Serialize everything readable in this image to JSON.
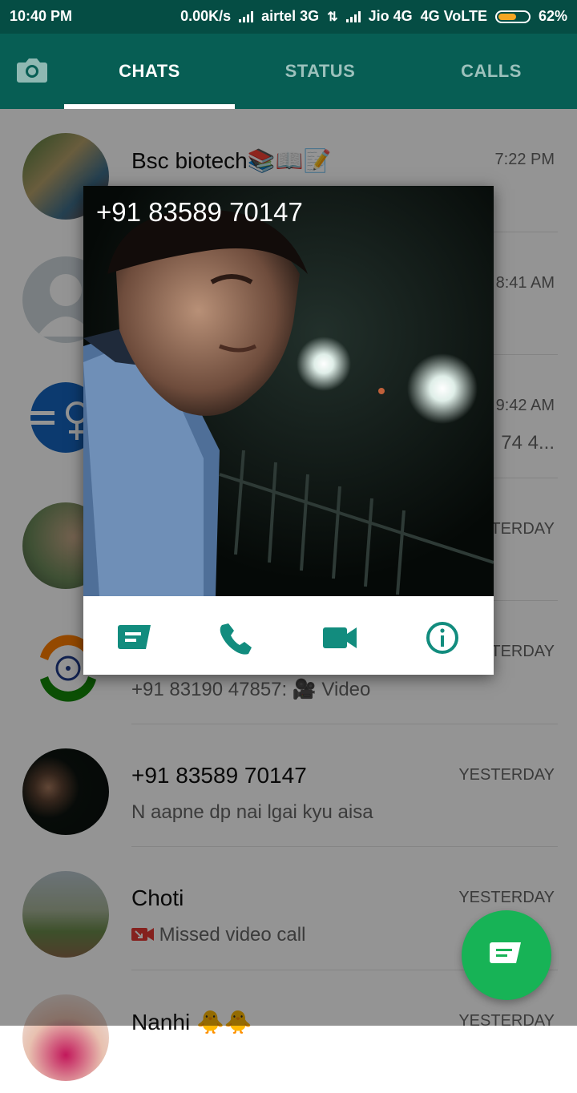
{
  "status_bar": {
    "time": "10:40 PM",
    "speed": "0.00K/s",
    "carrier1": "airtel 3G",
    "carrier2": "Jio 4G",
    "network_type": "4G VoLTE",
    "battery_percent": "62%",
    "battery_level": 0.62
  },
  "tabs": {
    "chats": "CHATS",
    "status": "STATUS",
    "calls": "CALLS"
  },
  "chats": [
    {
      "name": "Bsc biotech📚📖📝",
      "time": "7:22 PM",
      "message": ""
    },
    {
      "name": "",
      "time": "8:41 AM",
      "message": ""
    },
    {
      "name": "",
      "time": "9:42 AM",
      "message": "74 4..."
    },
    {
      "name": "",
      "time": "YESTERDAY",
      "message": ""
    },
    {
      "name": "",
      "time": "YESTERDAY",
      "message": "+91 83190 47857: 🎥 Video"
    },
    {
      "name": "+91 83589 70147",
      "time": "YESTERDAY",
      "message": "N aapne dp nai lgai kyu aisa"
    },
    {
      "name": "Choti",
      "time": "YESTERDAY",
      "message": "Missed video call"
    },
    {
      "name": "Nanhi 🐥🐥",
      "time": "YESTERDAY",
      "message": ""
    }
  ],
  "popup": {
    "title": "+91 83589 70147",
    "actions": [
      "message-icon",
      "call-icon",
      "video-call-icon",
      "info-icon"
    ]
  },
  "colors": {
    "header": "#075e54",
    "status_bar": "#054d44",
    "accent": "#128c7e",
    "fab": "#17b356"
  }
}
